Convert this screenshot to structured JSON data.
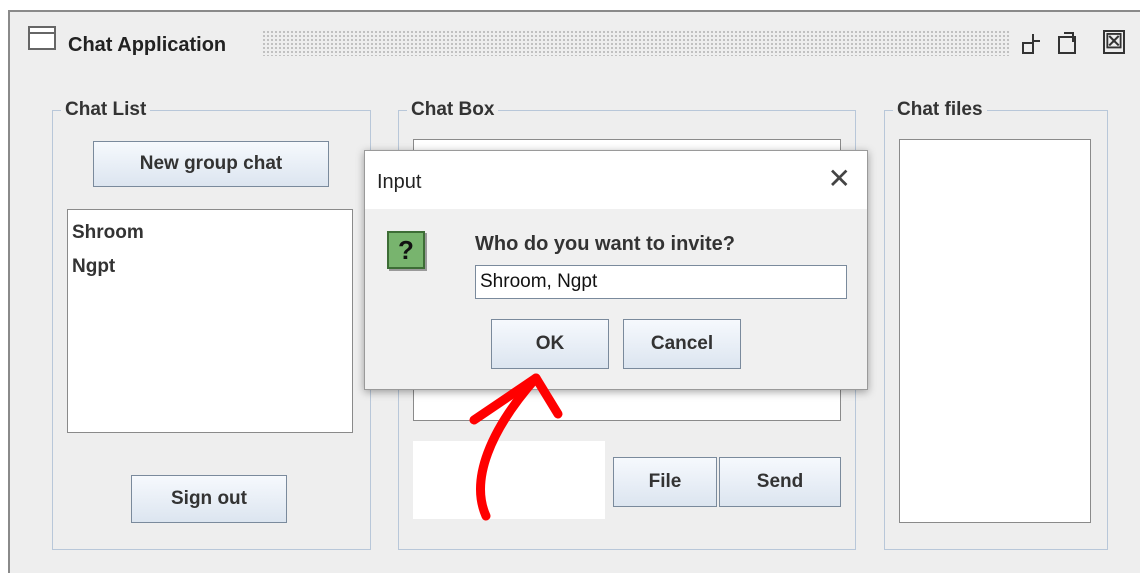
{
  "window": {
    "title": "Chat Application",
    "icon": "window-icon",
    "controls": [
      "restore-icon",
      "maximize-icon",
      "close-icon"
    ],
    "close_glyph": "☒"
  },
  "chat_list": {
    "label": "Chat List",
    "new_group_button": "New group chat",
    "items": [
      "Shroom",
      "Ngpt"
    ],
    "sign_out_button": "Sign out"
  },
  "chat_box": {
    "label": "Chat Box",
    "message_input_value": "",
    "file_button": "File",
    "send_button": "Send"
  },
  "chat_files": {
    "label": "Chat files"
  },
  "dialog": {
    "title": "Input",
    "close_glyph": "✕",
    "icon_glyph": "?",
    "prompt": "Who do you want to invite?",
    "input_value": "Shroom, Ngpt",
    "ok_button": "OK",
    "cancel_button": "Cancel"
  },
  "colors": {
    "annotation_arrow": "#ff0000",
    "panel_border": "#b8c7d9",
    "question_icon": "#78b46e"
  }
}
